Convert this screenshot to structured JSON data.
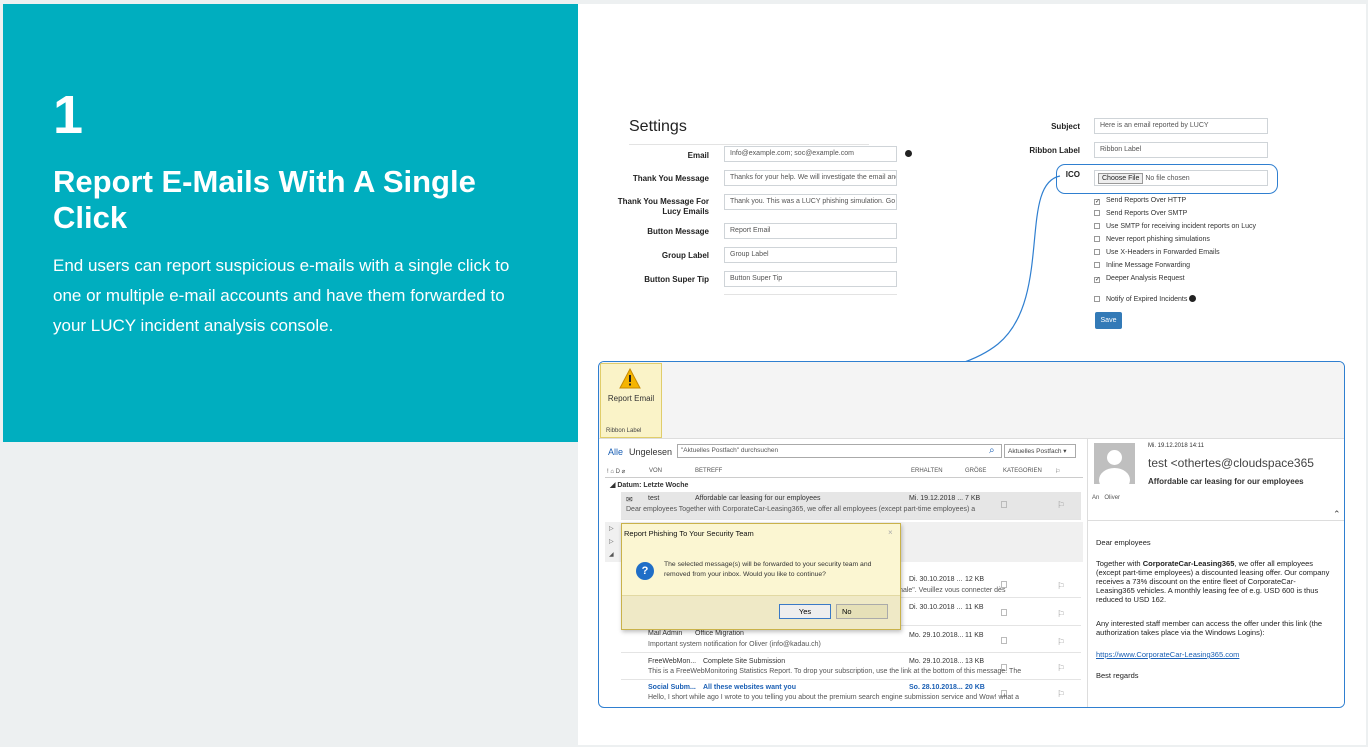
{
  "hero": {
    "step": "1",
    "title": "Report E-Mails With A Single Click",
    "description": "End users can report suspicious e-mails with a single click to one or multiple e-mail accounts and have them forwarded to your LUCY incident analysis console."
  },
  "settings": {
    "heading": "Settings",
    "fields": [
      {
        "label": "Email",
        "value": "Info@example.com; soc@example.com"
      },
      {
        "label": "Thank You Message",
        "value": "Thanks for your help. We will investigate the email and"
      },
      {
        "label": "Thank You Message For Lucy Emails",
        "value": "Thank you. This was a LUCY phishing simulation. Go"
      },
      {
        "label": "Button Message",
        "value": "Report Email"
      },
      {
        "label": "Group Label",
        "value": "Group Label"
      },
      {
        "label": "Button Super Tip",
        "value": "Button Super Tip"
      }
    ],
    "subject_label": "Subject",
    "subject_value": "Here is an email reported by LUCY",
    "ribbon_label": "Ribbon Label",
    "ribbon_value": "Ribbon Label",
    "ico_label": "ICO",
    "choose_file": "Choose File",
    "no_file": "No file chosen",
    "options": [
      {
        "label": "Send Reports Over HTTP",
        "checked": true
      },
      {
        "label": "Send Reports Over SMTP",
        "checked": false
      },
      {
        "label": "Use SMTP for receiving incident reports on Lucy",
        "checked": false
      },
      {
        "label": "Never report phishing simulations",
        "checked": false
      },
      {
        "label": "Use X-Headers in Forwarded Emails",
        "checked": false
      },
      {
        "label": "Inline Message Forwarding",
        "checked": false
      },
      {
        "label": "Deeper Analysis Request",
        "checked": true
      }
    ],
    "notify_label": "Notify of Expired Incidents",
    "save_label": "Save"
  },
  "ribbon": {
    "button": "Report Email",
    "group": "Ribbon Label"
  },
  "mail": {
    "filter_all": "Alle",
    "filter_unread": "Ungelesen",
    "search_placeholder": "\"Aktuelles Postfach\" durchsuchen",
    "scope": "Aktuelles Postfach",
    "cols": {
      "from": "VON",
      "subject": "BETREFF",
      "received": "ERHALTEN",
      "size": "GRÖßE",
      "categories": "KATEGORIEN"
    },
    "group": "Datum: Letzte Woche",
    "rows": [
      {
        "from": "test",
        "subject": "Affordable car leasing for our employees",
        "date": "Mi. 19.12.2018 ...",
        "size": "7 KB",
        "preview": "Dear employees  Together with CorporateCar-Leasing365, we offer all employees (except part-time employees) a"
      },
      {
        "from": "",
        "subject": "",
        "date": "Di. 30.10.2018 ...",
        "size": "12 KB",
        "preview": "normale\". Veuillez vous connecter dès"
      },
      {
        "from": "",
        "subject": "",
        "date": "Di. 30.10.2018 ...",
        "size": "11 KB",
        "preview": ""
      },
      {
        "from": "Mail Admin",
        "subject": "Office Migration",
        "date": "Mo. 29.10.2018...",
        "size": "11 KB",
        "preview": "Important system notification for Oliver (info@kadau.ch)"
      },
      {
        "from": "FreeWebMon...",
        "subject": "Complete Site Submission",
        "date": "Mo. 29.10.2018...",
        "size": "13 KB",
        "preview": "This is a FreeWebMonitoring Statistics Report.  To drop your subscription, use the link at the bottom of this message.  The"
      },
      {
        "from": "Social Subm...",
        "subject": "All these websites want you",
        "date": "So. 28.10.2018...",
        "size": "20 KB",
        "preview": "Hello,  I short while ago I wrote to you telling you about the premium search engine  submission service and Wow! what a"
      }
    ]
  },
  "dialog": {
    "title": "Report Phishing To Your Security Team",
    "message": "The selected message(s) will be forwarded to your security team and removed from your inbox. Would you like to continue?",
    "yes": "Yes",
    "no": "No"
  },
  "reading": {
    "date": "Mi. 19.12.2018 14:11",
    "from": "test <othertes@cloudspace365",
    "subject": "Affordable car leasing for our employees",
    "to_label": "An",
    "to": "Oliver",
    "greeting": "Dear employees",
    "p1_pre": "Together with ",
    "p1_bold": "CorporateCar-Leasing365",
    "p1_post": ", we offer all employees (except part-time employees) a discounted leasing offer. Our company receives a 73% discount on the entire fleet of CorporateCar-Leasing365 vehicles. A monthly leasing fee of e.g. USD 600 is thus reduced to USD 162.",
    "p2": "Any interested staff member can access the offer under this link (the authorization takes place via the Windows Logins):",
    "link": "https://www.CorporateCar-Leasing365.com",
    "closing": "Best regards"
  },
  "colors": {
    "teal": "#00aebf",
    "link": "#1a5fb4",
    "dialog_bg": "#fbf6d2",
    "accent": "#337ab7"
  }
}
